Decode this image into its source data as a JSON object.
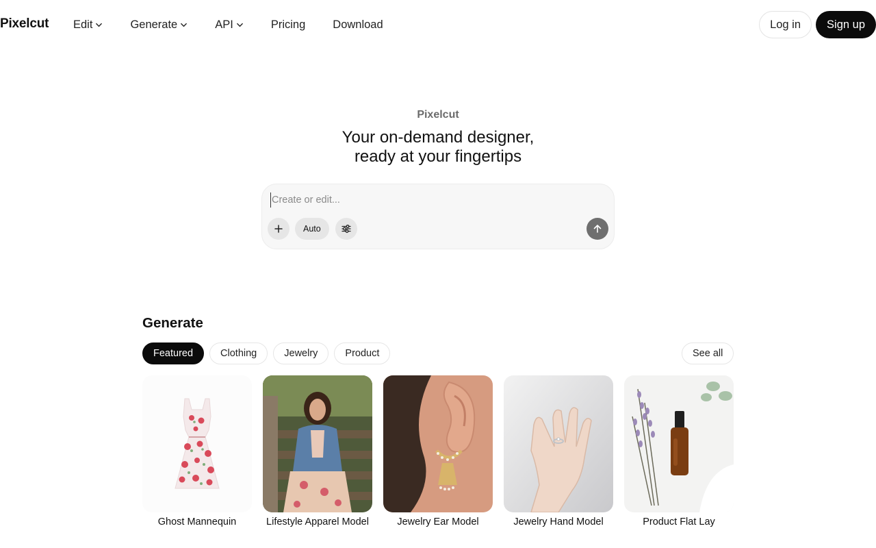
{
  "header": {
    "logo": "Pixelcut",
    "nav": [
      {
        "label": "Edit",
        "has_dropdown": true
      },
      {
        "label": "Generate",
        "has_dropdown": true
      },
      {
        "label": "API",
        "has_dropdown": true
      },
      {
        "label": "Pricing",
        "has_dropdown": false
      },
      {
        "label": "Download",
        "has_dropdown": false
      }
    ],
    "login_label": "Log in",
    "signup_label": "Sign up"
  },
  "hero": {
    "kicker": "Pixelcut",
    "title_line1": "Your on-demand designer,",
    "title_line2": "ready at your fingertips"
  },
  "prompt": {
    "placeholder": "Create or edit...",
    "value": "",
    "auto_label": "Auto",
    "icons": {
      "add": "plus-icon",
      "settings": "sliders-icon",
      "send": "arrow-up-icon"
    }
  },
  "generate": {
    "title": "Generate",
    "chips": [
      {
        "label": "Featured",
        "active": true
      },
      {
        "label": "Clothing",
        "active": false
      },
      {
        "label": "Jewelry",
        "active": false
      },
      {
        "label": "Product",
        "active": false
      }
    ],
    "see_all_label": "See all",
    "cards": [
      {
        "label": "Ghost Mannequin",
        "image": "floral-dress"
      },
      {
        "label": "Lifestyle Apparel Model",
        "image": "woman-denim-jacket-on-stairs"
      },
      {
        "label": "Jewelry Ear Model",
        "image": "gold-earring-on-ear"
      },
      {
        "label": "Jewelry Hand Model",
        "image": "hand-with-ring"
      },
      {
        "label": "Product Flat Lay",
        "image": "serum-bottle-with-lavender"
      }
    ]
  },
  "colors": {
    "primary": "#0b0b0b",
    "prompt_bg": "#f7f7f7",
    "button_grey": "#e6e6e6",
    "send_grey": "#6f6f6f",
    "muted_text": "#6b6b6b"
  }
}
